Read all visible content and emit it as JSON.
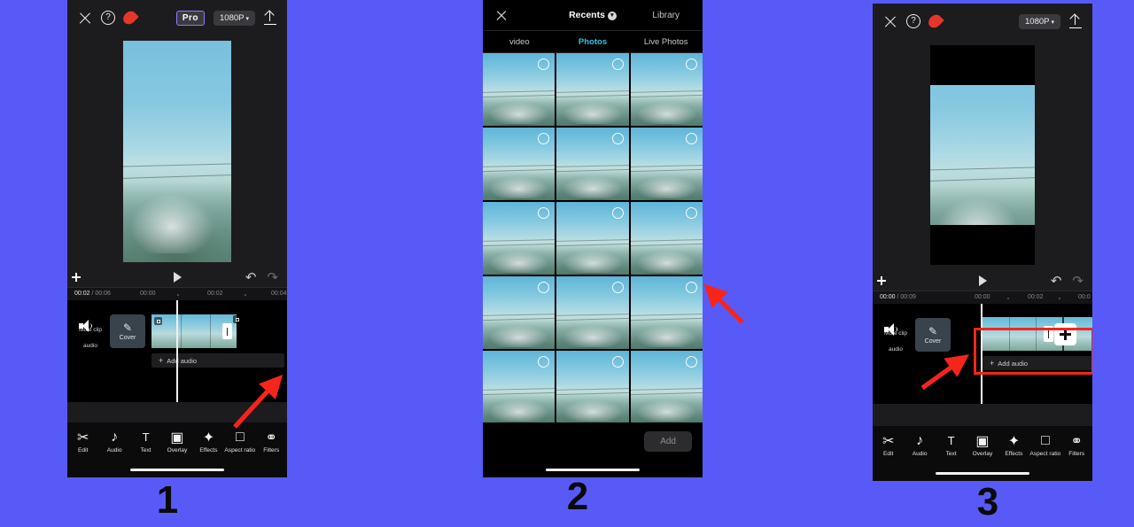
{
  "background_color": "#585AF7",
  "accent_red": "#F5251C",
  "accent_cyan": "#2BC6E8",
  "captions": [
    {
      "label": "1"
    },
    {
      "label": "2"
    },
    {
      "label": "3"
    }
  ],
  "panel1": {
    "name": "video-editor-before",
    "topbar": {
      "close_icon": "close-icon",
      "help_icon": "help-icon",
      "flame_icon": "flame-icon",
      "pro_badge": "Pro",
      "resolution": "1080P",
      "resolution_chevron": "▾",
      "export_icon": "upload-icon"
    },
    "controls": {
      "fullscreen_icon": "fullscreen-icon",
      "play_icon": "play-icon",
      "undo_icon": "undo-icon",
      "redo_icon": "redo-icon"
    },
    "ruler": {
      "current_time": "00:02",
      "separator": "/",
      "total_time": "00:06",
      "ticks": [
        "00:00",
        "00:02",
        "00:04"
      ]
    },
    "timeline": {
      "mute_label": "Mute clip audio",
      "mute_icon": "speaker-icon",
      "cover_label": "Cover",
      "cover_icon": "pencil-icon",
      "add_audio_label": "Add audio",
      "add_audio_plus": "+",
      "add_clip_button": "add-clip-button"
    },
    "toolbar": [
      {
        "label": "Edit",
        "icon": "scissors-icon"
      },
      {
        "label": "Audio",
        "icon": "music-note-icon"
      },
      {
        "label": "Text",
        "icon": "text-t-icon"
      },
      {
        "label": "Overlay",
        "icon": "overlay-icon"
      },
      {
        "label": "Effects",
        "icon": "sparkle-icon"
      },
      {
        "label": "Aspect ratio",
        "icon": "square-icon"
      },
      {
        "label": "Filters",
        "icon": "filters-icon"
      }
    ]
  },
  "panel2": {
    "name": "media-picker",
    "header": {
      "close_icon": "close-icon",
      "title": "Recents",
      "title_chevron_icon": "chevron-down-icon",
      "library_label": "Library"
    },
    "tabs": [
      {
        "label": "video",
        "active": false
      },
      {
        "label": "Photos",
        "active": true
      },
      {
        "label": "Live Photos",
        "active": false
      }
    ],
    "grid": {
      "columns": 3,
      "rows": 5,
      "cell_select_icon": "selection-circle-icon",
      "highlighted_cell_index": 1
    },
    "footer": {
      "add_label": "Add"
    }
  },
  "panel3": {
    "name": "video-editor-after",
    "topbar": {
      "close_icon": "close-icon",
      "help_icon": "help-icon",
      "flame_icon": "flame-icon",
      "resolution": "1080P",
      "resolution_chevron": "▾",
      "export_icon": "upload-icon"
    },
    "controls": {
      "fullscreen_icon": "fullscreen-icon",
      "play_icon": "play-icon",
      "undo_icon": "undo-icon",
      "redo_icon": "redo-icon"
    },
    "ruler": {
      "current_time": "00:00",
      "separator": "/",
      "total_time": "00:09",
      "ticks": [
        "00:00",
        "00:02",
        "00:0"
      ]
    },
    "timeline": {
      "mute_label": "Mute clip audio",
      "mute_icon": "speaker-icon",
      "cover_label": "Cover",
      "cover_icon": "pencil-icon",
      "add_audio_label": "Add audio",
      "add_audio_plus": "+",
      "add_clip_button": "add-clip-button"
    },
    "toolbar": [
      {
        "label": "Edit",
        "icon": "scissors-icon"
      },
      {
        "label": "Audio",
        "icon": "music-note-icon"
      },
      {
        "label": "Text",
        "icon": "text-t-icon"
      },
      {
        "label": "Overlay",
        "icon": "overlay-icon"
      },
      {
        "label": "Effects",
        "icon": "sparkle-icon"
      },
      {
        "label": "Aspect ratio",
        "icon": "square-icon"
      },
      {
        "label": "Filters",
        "icon": "filters-icon"
      }
    ]
  },
  "annotations": [
    {
      "type": "rectangle",
      "target": "panel1-add-clip-button",
      "color": "#F5251C"
    },
    {
      "type": "arrow",
      "target": "panel1-add-clip-button",
      "color": "#F5251C"
    },
    {
      "type": "arrow",
      "target": "panel2-photo-grid",
      "color": "#F5251C"
    },
    {
      "type": "rectangle",
      "target": "panel3-clip-track",
      "color": "#F5251C"
    },
    {
      "type": "arrow",
      "target": "panel3-clip-track",
      "color": "#F5251C"
    }
  ]
}
